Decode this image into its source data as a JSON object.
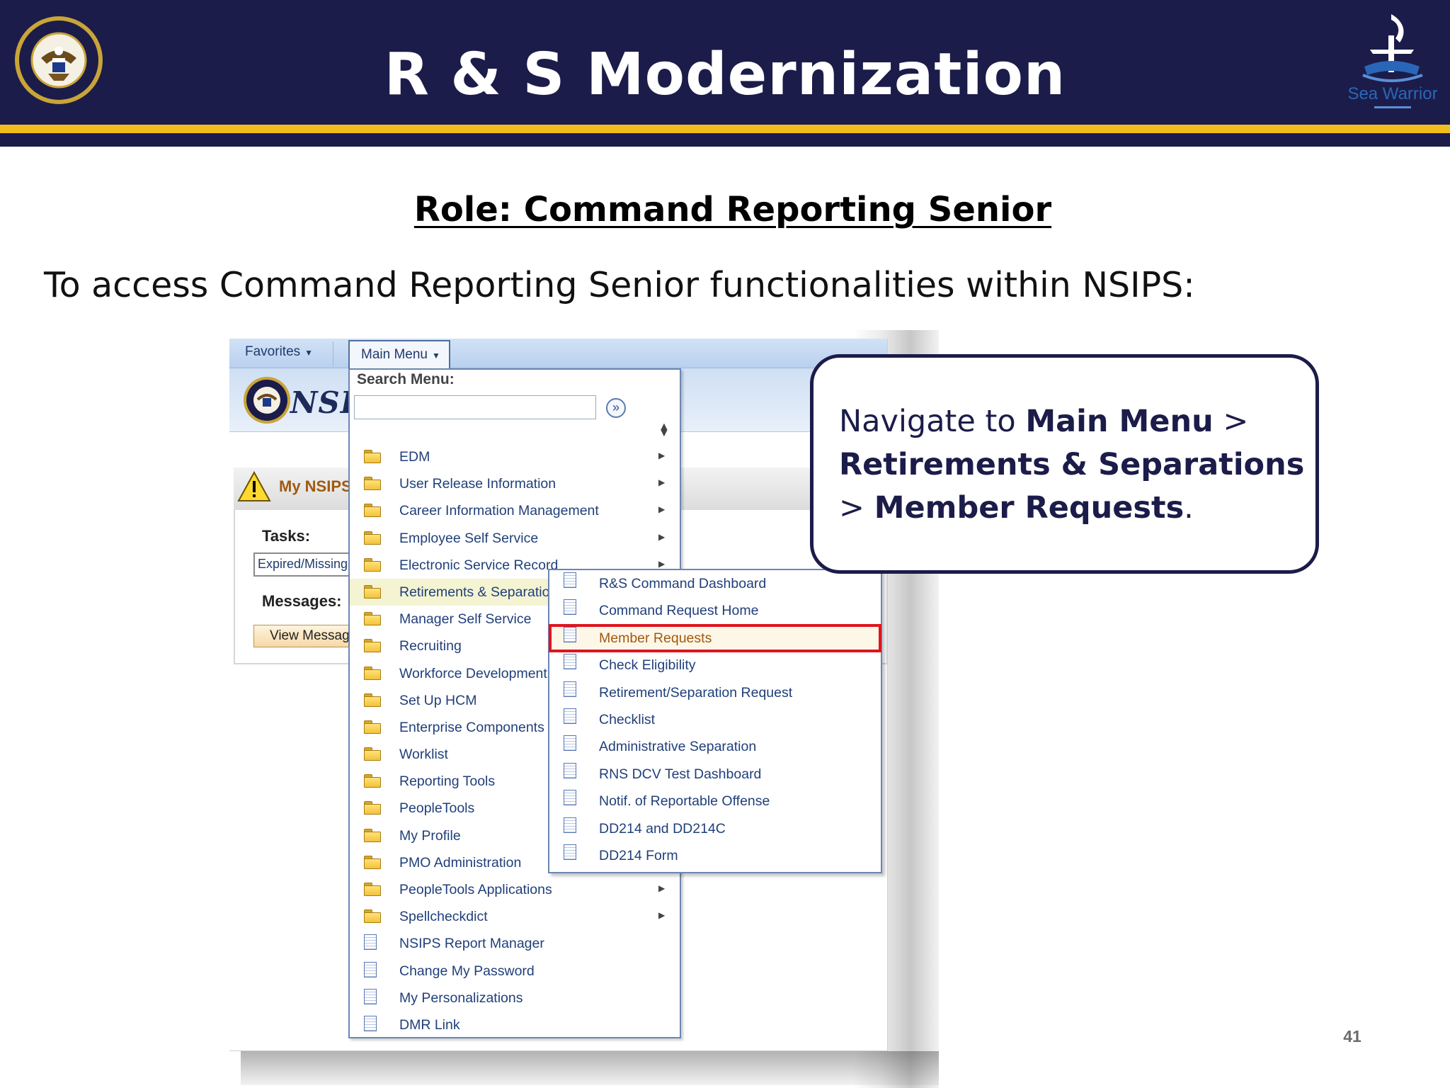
{
  "slide": {
    "title": "R & S Modernization",
    "role_heading": "Role: Command Reporting Senior",
    "intro": "To access Command Reporting Senior functionalities within NSIPS:",
    "page_number": "41",
    "colors": {
      "navy": "#1c1c4a",
      "gold": "#f1bd1d",
      "highlight_red": "#e0141e"
    }
  },
  "logos": {
    "left": "us-navy-seal",
    "right": "sea-warrior-logo"
  },
  "screenshot": {
    "topbar": {
      "favorites_label": "Favorites",
      "main_menu_label": "Main Menu"
    },
    "banner_text": "NSIPS",
    "my_nsips": {
      "title": "My NSIPS",
      "tasks_label": "Tasks:",
      "tasks_value": "Expired/Missing",
      "messages_label": "Messages:",
      "view_messages_label": "View Messages"
    },
    "menu": {
      "search_label": "Search Menu:",
      "search_value": "",
      "items": [
        {
          "label": "EDM",
          "icon": "folder-icon",
          "arrow": "▶"
        },
        {
          "label": "User Release Information",
          "icon": "folder-icon",
          "arrow": "▶"
        },
        {
          "label": "Career Information Management",
          "icon": "folder-icon",
          "arrow": "▶"
        },
        {
          "label": "Employee Self Service",
          "icon": "folder-icon",
          "arrow": "▶"
        },
        {
          "label": "Electronic Service Record",
          "icon": "folder-icon",
          "arrow": "▶"
        },
        {
          "label": "Retirements & Separations",
          "icon": "folder-icon",
          "arrow": ""
        },
        {
          "label": "Manager Self Service",
          "icon": "folder-icon",
          "arrow": ""
        },
        {
          "label": "Recruiting",
          "icon": "folder-icon",
          "arrow": ""
        },
        {
          "label": "Workforce Development",
          "icon": "folder-icon",
          "arrow": ""
        },
        {
          "label": "Set Up HCM",
          "icon": "folder-icon",
          "arrow": ""
        },
        {
          "label": "Enterprise Components",
          "icon": "folder-icon",
          "arrow": ""
        },
        {
          "label": "Worklist",
          "icon": "folder-icon",
          "arrow": ""
        },
        {
          "label": "Reporting Tools",
          "icon": "folder-icon",
          "arrow": ""
        },
        {
          "label": "PeopleTools",
          "icon": "folder-icon",
          "arrow": ""
        },
        {
          "label": "My Profile",
          "icon": "folder-icon",
          "arrow": ""
        },
        {
          "label": "PMO Administration",
          "icon": "folder-icon",
          "arrow": ""
        },
        {
          "label": "PeopleTools Applications",
          "icon": "folder-icon",
          "arrow": "▶"
        },
        {
          "label": "Spellcheckdict",
          "icon": "folder-icon",
          "arrow": "▶"
        },
        {
          "label": "NSIPS Report Manager",
          "icon": "document-icon",
          "arrow": ""
        },
        {
          "label": "Change My Password",
          "icon": "document-icon",
          "arrow": ""
        },
        {
          "label": "My Personalizations",
          "icon": "document-icon",
          "arrow": ""
        },
        {
          "label": "DMR Link",
          "icon": "document-icon",
          "arrow": ""
        }
      ]
    },
    "submenu": {
      "items": [
        {
          "label": "R&S Command Dashboard",
          "icon": "document-icon"
        },
        {
          "label": "Command Request Home",
          "icon": "document-icon"
        },
        {
          "label": "Member Requests",
          "icon": "document-icon"
        },
        {
          "label": "Check Eligibility",
          "icon": "document-icon"
        },
        {
          "label": "Retirement/Separation Request",
          "icon": "document-icon"
        },
        {
          "label": "Checklist",
          "icon": "document-icon"
        },
        {
          "label": "Administrative Separation",
          "icon": "document-icon"
        },
        {
          "label": "RNS DCV Test Dashboard",
          "icon": "document-icon"
        },
        {
          "label": "Notif. of Reportable Offense",
          "icon": "document-icon"
        },
        {
          "label": "DD214 and DD214C",
          "icon": "document-icon"
        },
        {
          "label": "DD214 Form",
          "icon": "document-icon"
        }
      ]
    }
  },
  "callout": {
    "prefix": "Navigate to ",
    "step1": "Main Menu",
    "sep1": " > ",
    "step2": "Retirements & Separations",
    "sep2": " > ",
    "step3": "Member Requests",
    "suffix": "."
  }
}
